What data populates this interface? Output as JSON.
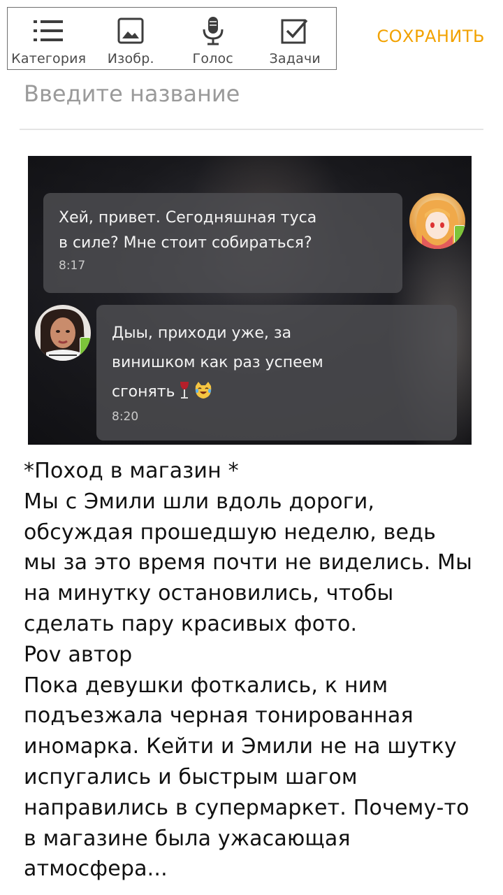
{
  "toolbar": {
    "items": [
      {
        "label": "Категория",
        "icon": "list-icon"
      },
      {
        "label": "Изобр.",
        "icon": "image-icon"
      },
      {
        "label": "Голос",
        "icon": "microphone-icon"
      },
      {
        "label": "Задачи",
        "icon": "checkbox-icon"
      }
    ],
    "save_label": "СОХРАНИТЬ",
    "accent_color": "#f2a200"
  },
  "title": {
    "placeholder": "Введите название",
    "value": ""
  },
  "image": {
    "message1": {
      "text": "Хей, привет. Сегодняшная туса\nв силе? Мне стоит собираться?",
      "time": "8:17"
    },
    "message2": {
      "text": "Дыы, приходи уже, за\nвинишком как раз успеем\nсгонять",
      "emojis": [
        "wine-glass-icon",
        "cat-tears-of-joy-icon"
      ],
      "time": "8:20"
    }
  },
  "story": {
    "lines": [
      "*Поход в магазин *",
      "Мы с Эмили шли вдоль дороги,",
      "обсуждая прошедшую неделю, ведь",
      "мы за это время почти не виделись. Мы",
      "на минутку остановились, чтобы",
      "сделать пару красивых фото.",
      "Pov автор",
      "Пока девушки фоткались, к ним",
      "подъезжала черная тонированная",
      "иномарка. Кейти и Эмили не на шутку",
      "испугались и быстрым шагом",
      "направились в супермаркет. Почему-то",
      "в магазине была ужасающая",
      "атмосфера..."
    ]
  }
}
